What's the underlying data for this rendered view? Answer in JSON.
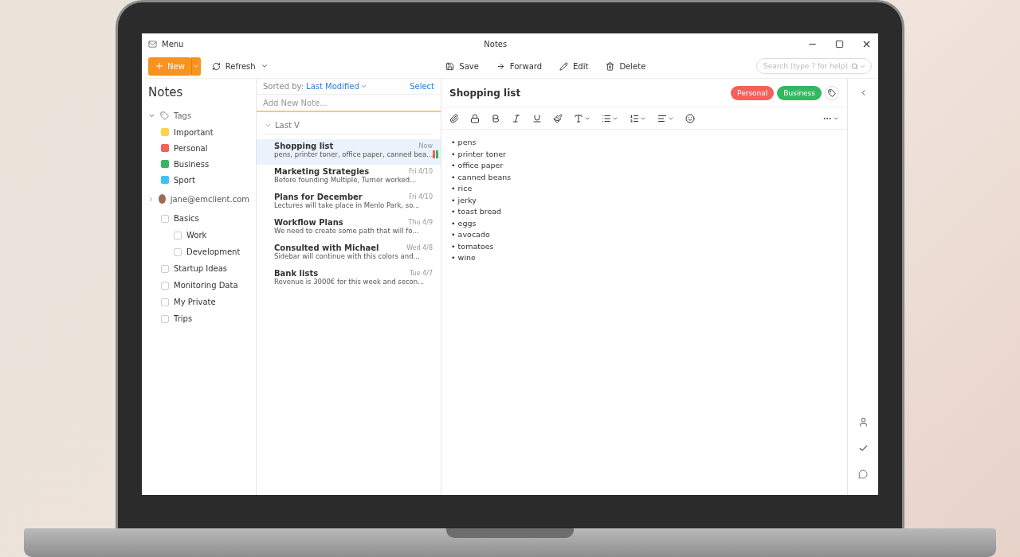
{
  "window": {
    "menu": "Menu",
    "title": "Notes"
  },
  "toolbar": {
    "new_label": "New",
    "refresh_label": "Refresh",
    "actions": [
      {
        "kind": "save",
        "label": "Save"
      },
      {
        "kind": "forward",
        "label": "Forward"
      },
      {
        "kind": "edit",
        "label": "Edit"
      },
      {
        "kind": "delete",
        "label": "Delete"
      }
    ],
    "search": {
      "placeholder": "Search (type ? for help)"
    }
  },
  "sidebar": {
    "title": "Notes",
    "tags": {
      "label": "Tags",
      "expanded": true,
      "items": [
        {
          "label": "Important",
          "color": "#fdd245"
        },
        {
          "label": "Personal",
          "color": "#f4605a"
        },
        {
          "label": "Business",
          "color": "#33b861"
        },
        {
          "label": "Sport",
          "color": "#3cc3f5"
        }
      ]
    },
    "account": {
      "label": "jane@emclient.com",
      "expanded": false
    },
    "folders": [
      {
        "label": "Basics",
        "checked": false,
        "children": [
          {
            "label": "Work",
            "checked": false
          },
          {
            "label": "Development",
            "checked": false
          }
        ]
      },
      {
        "label": "Startup Ideas",
        "checked": false
      },
      {
        "label": "Monitoring Data",
        "checked": false
      },
      {
        "label": "My Private",
        "checked": false
      },
      {
        "label": "Trips",
        "checked": false
      }
    ]
  },
  "note_list": {
    "sorted_by_label": "Sorted by:",
    "sorted_by_value": "Last Modified",
    "select_label": "Select",
    "add_placeholder": "Add New Note...",
    "group": {
      "label": "Last V",
      "expanded": true
    },
    "notes": [
      {
        "title": "Shopping list",
        "preview": "pens, printer toner, office paper, canned bea...",
        "date": "Now",
        "selected": true,
        "tags": [
          {
            "color": "#f4605a"
          },
          {
            "color": "#33b861"
          }
        ]
      },
      {
        "title": "Marketing Strategies",
        "preview": "Before founding Multiple, Turner worked...",
        "date": "Fri 4/10",
        "selected": false
      },
      {
        "title": "Plans for December",
        "preview": "Lectures will take place in Menlo Park, so...",
        "date": "Fri 4/10",
        "selected": false
      },
      {
        "title": "Workflow Plans",
        "preview": "We need to create some path that will fo...",
        "date": "Thu 4/9",
        "selected": false
      },
      {
        "title": "Consulted with Michael",
        "preview": "Sidebar will continue with this colors and...",
        "date": "Wed 4/8",
        "selected": false
      },
      {
        "title": "Bank lists",
        "preview": "Revenue is 3000€ for this week and secon...",
        "date": "Tue 4/7",
        "selected": false
      }
    ]
  },
  "editor": {
    "title": "Shopping list",
    "tags": [
      {
        "label": "Personal",
        "color": "#f4605a"
      },
      {
        "label": "Business",
        "color": "#33b861"
      }
    ],
    "lines": [
      "• pens",
      "• printer toner",
      "• office paper",
      "• canned beans",
      "• rice",
      "• jerky",
      "• toast bread",
      "• eggs",
      "• avocado",
      "• tomatoes",
      "• wine"
    ]
  }
}
